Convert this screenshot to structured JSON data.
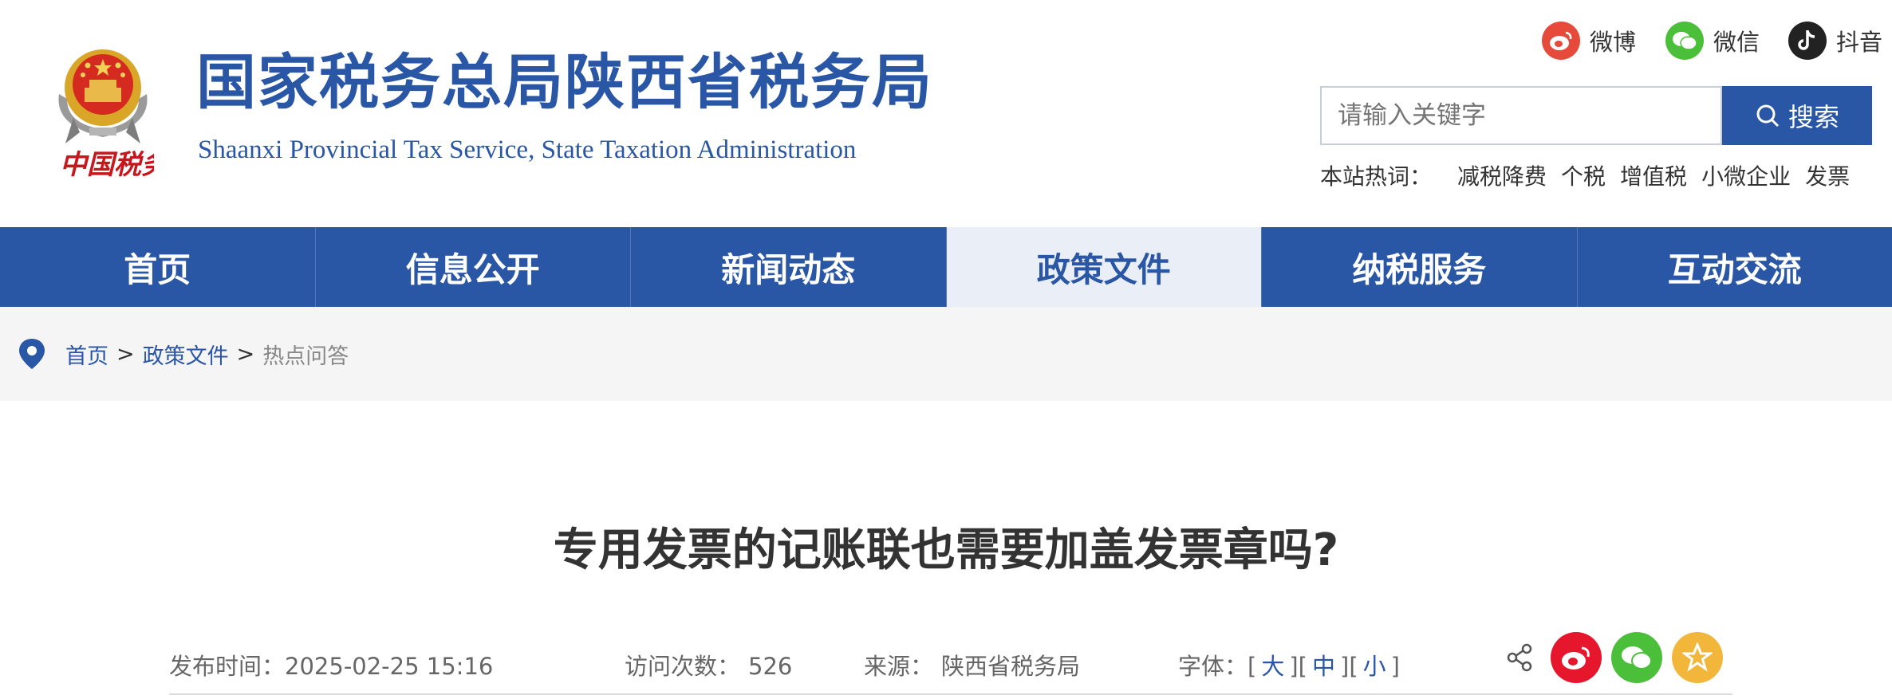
{
  "site": {
    "title_zh": "国家税务总局陕西省税务局",
    "title_en": "Shaanxi Provincial Tax Service, State Taxation Administration",
    "logo_text": "中国税务"
  },
  "social": {
    "weibo": "微博",
    "wechat": "微信",
    "douyin": "抖音"
  },
  "search": {
    "placeholder": "请输入关键字",
    "button": "搜索"
  },
  "hotwords": {
    "label": "本站热词：",
    "items": [
      "减税降费",
      "个税",
      "增值税",
      "小微企业",
      "发票"
    ]
  },
  "nav": {
    "items": [
      "首页",
      "信息公开",
      "新闻动态",
      "政策文件",
      "纳税服务",
      "互动交流"
    ],
    "active_index": 3
  },
  "breadcrumb": {
    "home": "首页",
    "section": "政策文件",
    "current": "热点问答",
    "sep": ">"
  },
  "article": {
    "title": "专用发票的记账联也需要加盖发票章吗?",
    "publish_label": "发布时间：",
    "publish_time": "2025-02-25 15:16",
    "visits_label": "访问次数：",
    "visits": "526",
    "source_label": "来源：",
    "source": "陕西省税务局",
    "font_label": "字体：",
    "font_large": "大",
    "font_medium": "中",
    "font_small": "小"
  },
  "colors": {
    "brand": "#2a56a6",
    "weibo": "#e6162d",
    "wechat": "#4cbf3a",
    "favorite": "#f2b73a"
  }
}
